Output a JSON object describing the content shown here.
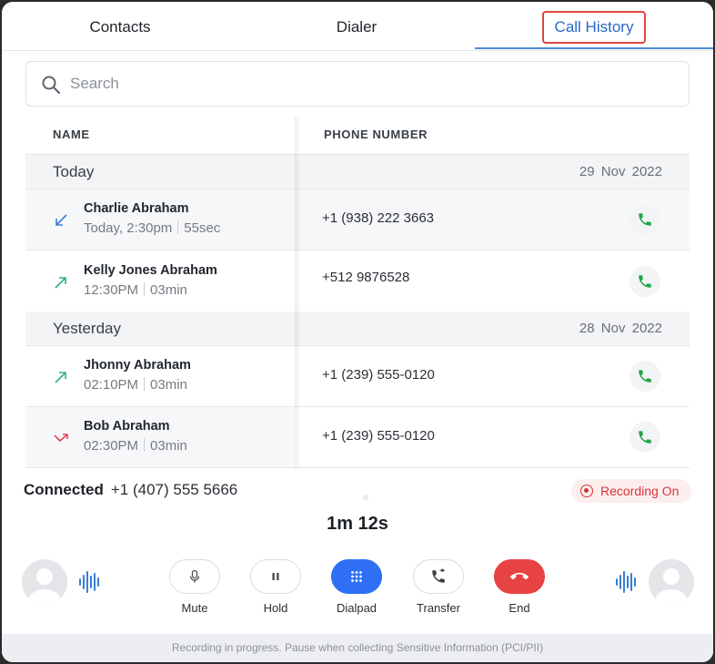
{
  "tabs": {
    "contacts": "Contacts",
    "dialer": "Dialer",
    "call_history": "Call History"
  },
  "search": {
    "placeholder": "Search"
  },
  "table": {
    "col_name": "NAME",
    "col_phone": "PHONE NUMBER",
    "sections": [
      {
        "label": "Today",
        "date": "29 Nov 2022"
      },
      {
        "label": "Yesterday",
        "date": "28 Nov 2022"
      }
    ],
    "rows": [
      {
        "name": "Charlie Abraham",
        "time": "Today, 2:30pm",
        "duration": "55sec",
        "phone": "+1 (938) 222 3663",
        "direction": "incoming"
      },
      {
        "name": "Kelly Jones Abraham",
        "time": "12:30PM",
        "duration": "03min",
        "phone": "+512 9876528",
        "direction": "outgoing"
      },
      {
        "name": "Jhonny Abraham",
        "time": "02:10PM",
        "duration": "03min",
        "phone": "+1 (239) 555-0120",
        "direction": "outgoing"
      },
      {
        "name": "Bob Abraham",
        "time": "02:30PM",
        "duration": "03min",
        "phone": "+1 (239) 555-0120",
        "direction": "missed"
      }
    ]
  },
  "call": {
    "status": "Connected",
    "number": "+1 (407) 555 5666",
    "recording": "Recording On",
    "timer": "1m 12s"
  },
  "controls": {
    "mute": "Mute",
    "hold": "Hold",
    "dialpad": "Dialpad",
    "transfer": "Transfer",
    "end": "End"
  },
  "footer": "Recording in progress. Pause when collecting Sensitive Information (PCI/PII)",
  "colors": {
    "accent": "#2a67c9",
    "call_green": "#1fa64a",
    "incoming": "#3b7dd8",
    "outgoing": "#2cb57a",
    "missed": "#e0465a",
    "end_red": "#e84343",
    "dialpad_blue": "#2f6ff3"
  }
}
